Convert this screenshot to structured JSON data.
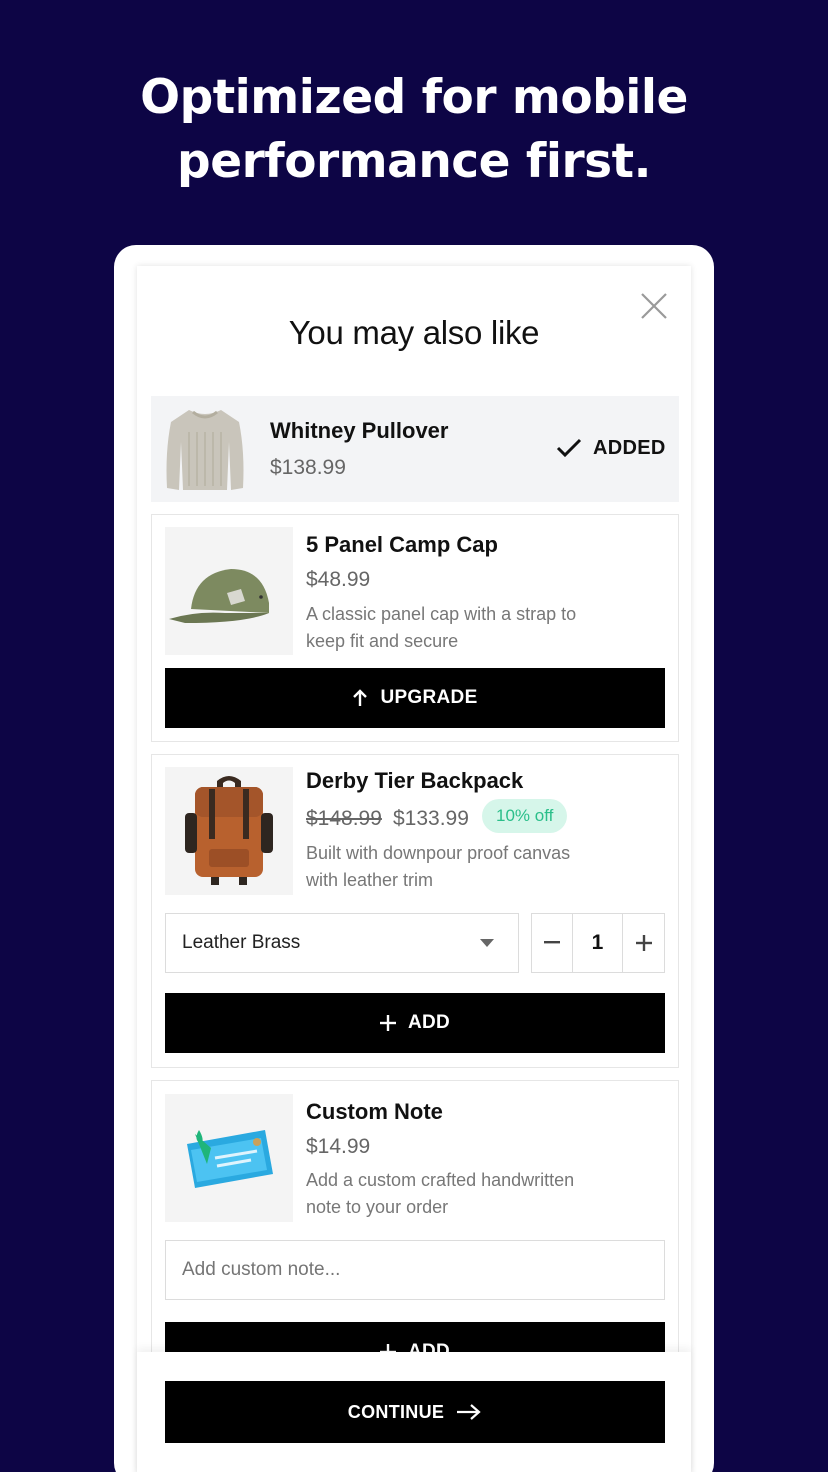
{
  "headline": {
    "line1": "Optimized for mobile",
    "line2": "performance first."
  },
  "modal": {
    "title": "You may also like"
  },
  "added_item": {
    "name": "Whitney Pullover",
    "price": "$138.99",
    "status": "ADDED"
  },
  "products": [
    {
      "name": "5 Panel Camp Cap",
      "price": "$48.99",
      "desc1": "A classic panel cap with a strap to",
      "desc2": "keep fit and secure",
      "button": "UPGRADE"
    },
    {
      "name": "Derby Tier Backpack",
      "old_price": "$148.99",
      "price": "$133.99",
      "badge": "10% off",
      "desc1": "Built with downpour proof canvas",
      "desc2": "with leather trim",
      "variant": "Leather Brass",
      "quantity": "1",
      "button": "ADD"
    },
    {
      "name": "Custom Note",
      "price": "$14.99",
      "desc1": "Add a custom crafted handwritten",
      "desc2": "note to your order",
      "placeholder": "Add custom note...",
      "button": "ADD"
    }
  ],
  "footer": {
    "continue": "CONTINUE"
  },
  "colors": {
    "background": "#0d0545",
    "button": "#000000",
    "badge_bg": "#d6f6ea",
    "badge_text": "#2bbf8a"
  }
}
